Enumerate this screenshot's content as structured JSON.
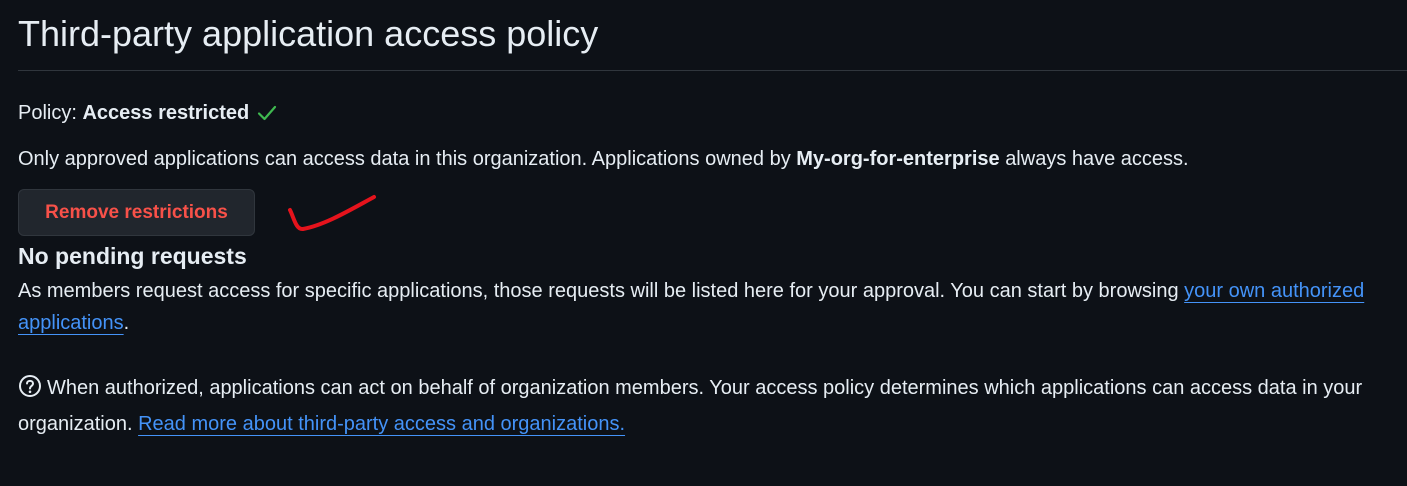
{
  "header": {
    "title": "Third-party application access policy"
  },
  "policy": {
    "label": "Policy:",
    "status": "Access restricted",
    "status_icon": "check-icon",
    "status_color": "#3fb950"
  },
  "description": {
    "text_before": "Only approved applications can access data in this organization. Applications owned by",
    "org_name": "My-org-for-enterprise",
    "text_after": "always have access."
  },
  "actions": {
    "remove_restrictions_label": "Remove restrictions",
    "danger_color": "#f85149"
  },
  "pending": {
    "heading": "No pending requests",
    "text": "As members request access for specific applications, those requests will be listed here for your approval. You can start by browsing",
    "link_label": "your own authorized applications",
    "suffix": "."
  },
  "info": {
    "icon": "question-icon",
    "text": "When authorized, applications can act on behalf of organization members. Your access policy determines which applications can access data in your organization.",
    "link_label": "Read more about third-party access and organizations."
  },
  "colors": {
    "background": "#0d1117",
    "text": "#e6edf3",
    "link": "#4493f8",
    "annotation_mark": "#e5131c"
  }
}
